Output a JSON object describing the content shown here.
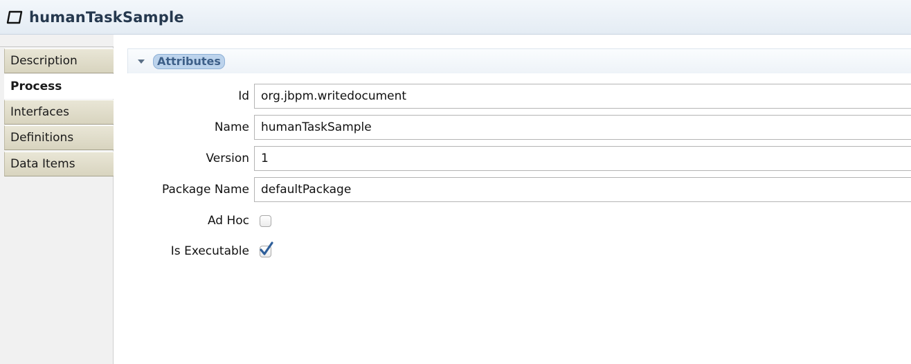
{
  "header": {
    "title": "humanTaskSample",
    "icon": "process-icon"
  },
  "tabs": [
    {
      "label": "Description",
      "selected": false
    },
    {
      "label": "Process",
      "selected": true
    },
    {
      "label": "Interfaces",
      "selected": false
    },
    {
      "label": "Definitions",
      "selected": false
    },
    {
      "label": "Data Items",
      "selected": false
    }
  ],
  "section": {
    "title": "Attributes",
    "expanded": true
  },
  "fields": {
    "id": {
      "label": "Id",
      "value": "org.jbpm.writedocument"
    },
    "name": {
      "label": "Name",
      "value": "humanTaskSample"
    },
    "version": {
      "label": "Version",
      "value": "1"
    },
    "package_name": {
      "label": "Package Name",
      "value": "defaultPackage"
    },
    "ad_hoc": {
      "label": "Ad Hoc",
      "checked": false
    },
    "is_executable": {
      "label": "Is Executable",
      "checked": true
    }
  },
  "colors": {
    "check_blue": "#2f5f9a",
    "section_title": "#3d5f88"
  }
}
